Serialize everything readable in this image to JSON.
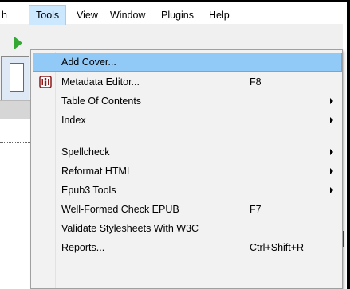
{
  "menubar": {
    "items": [
      {
        "label": "h"
      },
      {
        "label": "Tools"
      },
      {
        "label": "View"
      },
      {
        "label": "Window"
      },
      {
        "label": "Plugins"
      },
      {
        "label": "Help"
      }
    ]
  },
  "menu": {
    "items": [
      {
        "label": "Add Cover...",
        "shortcut": ""
      },
      {
        "label": "Metadata Editor...",
        "shortcut": "F8"
      },
      {
        "label": "Table Of Contents",
        "shortcut": ""
      },
      {
        "label": "Index",
        "shortcut": ""
      },
      {
        "label": "Spellcheck",
        "shortcut": ""
      },
      {
        "label": "Reformat HTML",
        "shortcut": ""
      },
      {
        "label": "Epub3 Tools",
        "shortcut": ""
      },
      {
        "label": "Well-Formed Check EPUB",
        "shortcut": "F7"
      },
      {
        "label": "Validate Stylesheets With W3C",
        "shortcut": ""
      },
      {
        "label": "Reports...",
        "shortcut": "Ctrl+Shift+R"
      }
    ]
  },
  "colors": {
    "highlight": "#91c9f7",
    "menubar_active": "#cce8ff",
    "icon_accent": "#8b1a1a"
  }
}
